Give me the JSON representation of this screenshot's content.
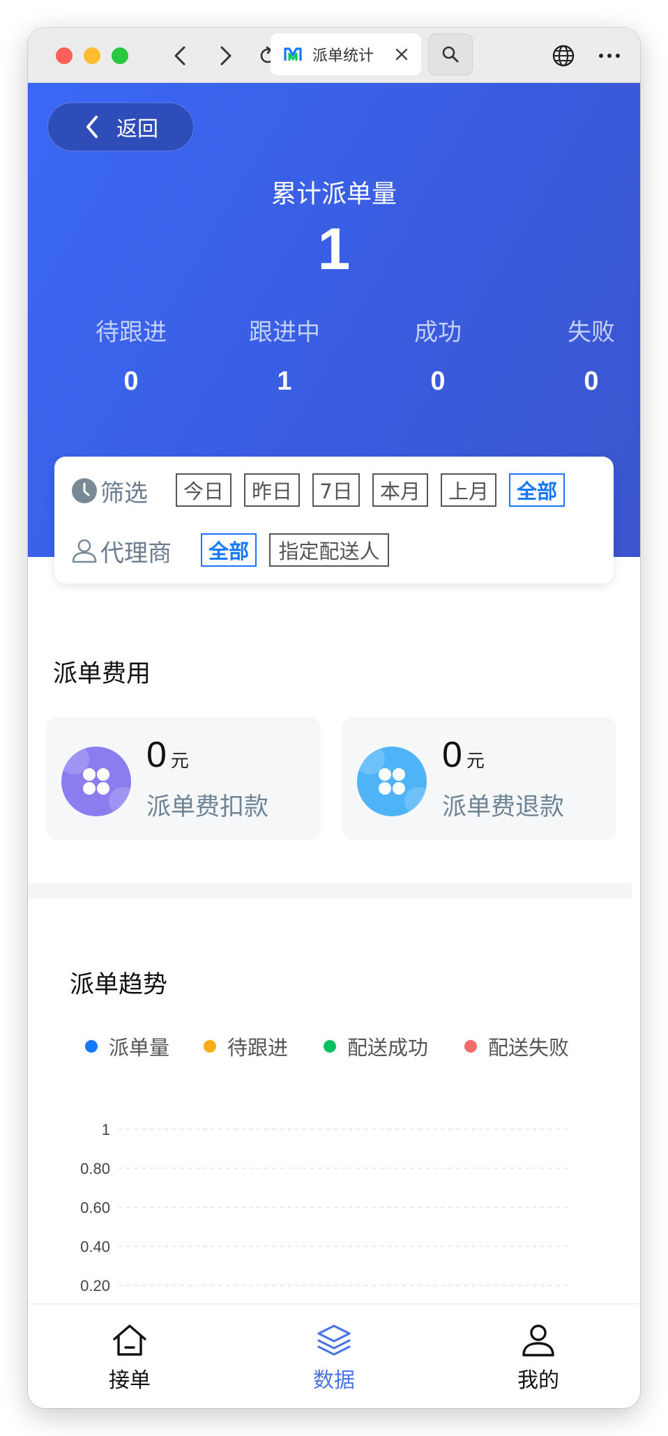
{
  "browser": {
    "tab_title": "派单统计"
  },
  "header": {
    "back_label": "返回",
    "title": "累计派单量",
    "total": "1"
  },
  "stats": [
    {
      "label": "待跟进",
      "value": "0"
    },
    {
      "label": "跟进中",
      "value": "1"
    },
    {
      "label": "成功",
      "value": "0"
    },
    {
      "label": "失败",
      "value": "0"
    }
  ],
  "filter": {
    "time_label": "筛选",
    "time_options": [
      "今日",
      "昨日",
      "7日",
      "本月",
      "上月",
      "全部"
    ],
    "time_selected": "全部",
    "agent_label": "代理商",
    "agent_options": [
      "全部",
      "指定配送人"
    ],
    "agent_selected": "全部"
  },
  "fees": {
    "title": "派单费用",
    "items": [
      {
        "amount": "0",
        "unit": "元",
        "label": "派单费扣款",
        "color": "#8b7df0"
      },
      {
        "amount": "0",
        "unit": "元",
        "label": "派单费退款",
        "color": "#4fb3f7"
      }
    ]
  },
  "trend": {
    "title": "派单趋势",
    "legend": [
      {
        "name": "派单量",
        "color": "#1677ff"
      },
      {
        "name": "待跟进",
        "color": "#faad14"
      },
      {
        "name": "配送成功",
        "color": "#07c160"
      },
      {
        "name": "配送失败",
        "color": "#f56c6c"
      }
    ]
  },
  "chart_data": {
    "type": "line",
    "y_ticks": [
      "1",
      "0.80",
      "0.60",
      "0.40",
      "0.20"
    ],
    "ylim": [
      0,
      1
    ],
    "grid": true,
    "series": [
      {
        "name": "派单量",
        "values": []
      },
      {
        "name": "待跟进",
        "values": []
      },
      {
        "name": "配送成功",
        "values": []
      },
      {
        "name": "配送失败",
        "values": []
      }
    ]
  },
  "nav": {
    "items": [
      {
        "label": "接单",
        "icon": "home-icon"
      },
      {
        "label": "数据",
        "icon": "layers-icon"
      },
      {
        "label": "我的",
        "icon": "user-icon"
      }
    ],
    "active_color": "#4b73e8"
  }
}
